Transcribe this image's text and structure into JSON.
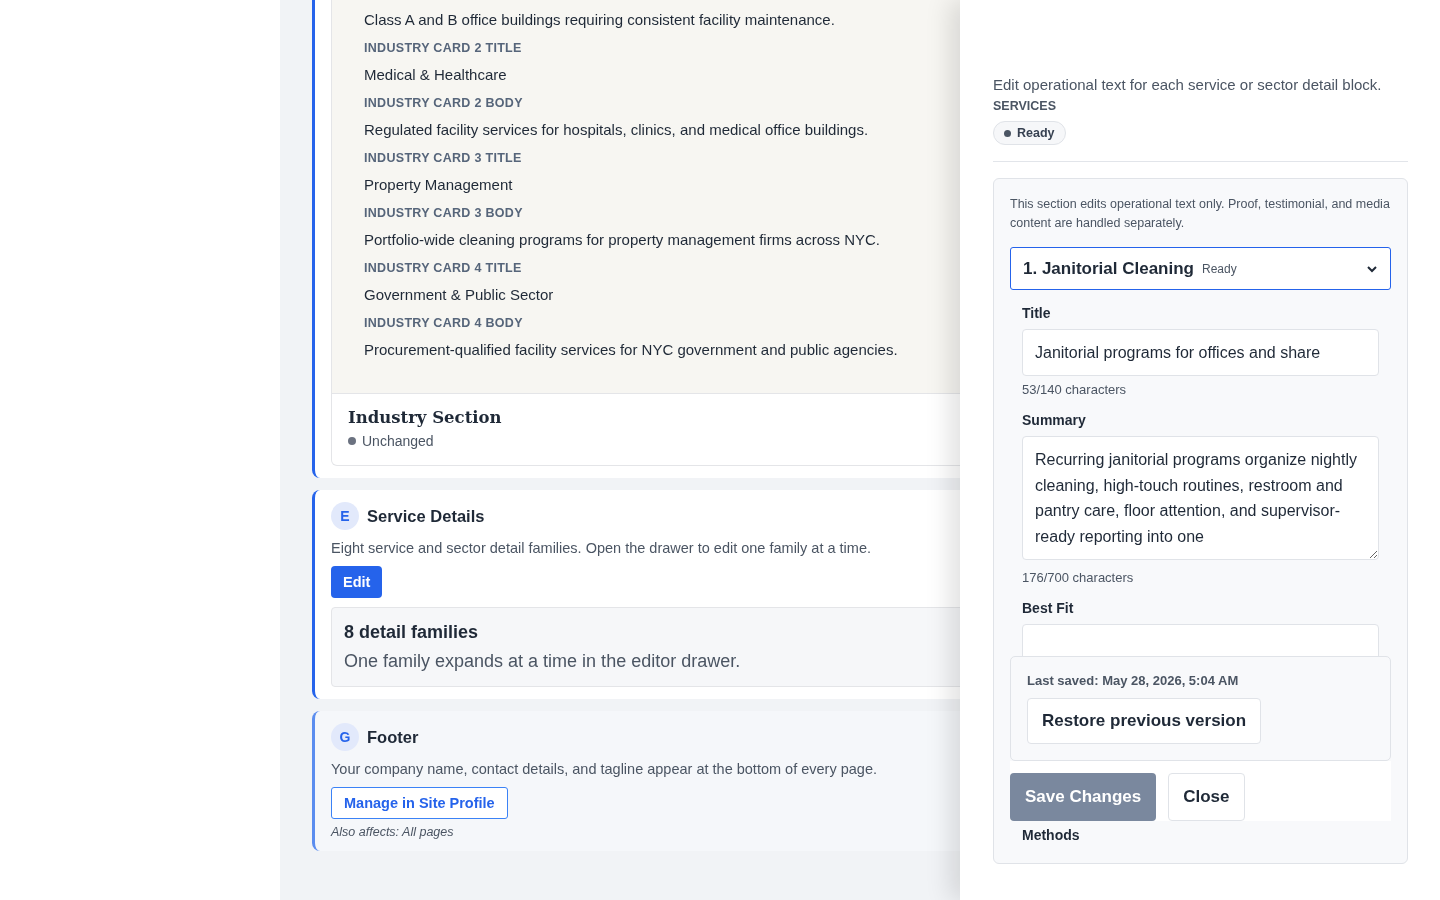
{
  "industry_panel": {
    "fields": [
      {
        "value": "Class A and B office buildings requiring consistent facility maintenance."
      },
      {
        "label": "INDUSTRY CARD 2 TITLE",
        "value": "Medical & Healthcare"
      },
      {
        "label": "INDUSTRY CARD 2 BODY",
        "value": "Regulated facility services for hospitals, clinics, and medical office buildings."
      },
      {
        "label": "INDUSTRY CARD 3 TITLE",
        "value": "Property Management"
      },
      {
        "label": "INDUSTRY CARD 3 BODY",
        "value": "Portfolio-wide cleaning programs for property management firms across NYC."
      },
      {
        "label": "INDUSTRY CARD 4 TITLE",
        "value": "Government & Public Sector"
      },
      {
        "label": "INDUSTRY CARD 4 BODY",
        "value": "Procurement-qualified facility services for NYC government and public agencies."
      }
    ],
    "title": "Industry Section",
    "status": "Unchanged"
  },
  "sections": [
    {
      "badge": "E",
      "title": "Service Details",
      "description": "Eight service and sector detail families. Open the drawer to edit one family at a time.",
      "button": {
        "label": "Edit",
        "kind": "primary"
      },
      "summary": {
        "title": "8 detail families",
        "text": "One family expands at a time in the editor drawer."
      },
      "selected": true
    },
    {
      "badge": "G",
      "title": "Footer",
      "description": "Your company name, contact details, and tagline appear at the bottom of every page.",
      "button": {
        "label": "Manage in Site Profile",
        "kind": "outline"
      },
      "note": "Also affects: All pages",
      "selected": false
    }
  ],
  "drawer": {
    "description": "Edit operational text for each service or sector detail block.",
    "section_label": "SERVICES",
    "status": "Ready",
    "note": "This section edits operational text only. Proof, testimonial, and media content are handled separately.",
    "dropdown": {
      "value": "1. Janitorial Cleaning",
      "status": "Ready"
    },
    "fields": [
      {
        "kind": "input",
        "label": "Title",
        "value": "Janitorial programs for offices and share",
        "counter": "53/140 characters"
      },
      {
        "kind": "textarea",
        "label": "Summary",
        "value": "Recurring janitorial programs organize nightly cleaning, high-touch routines, restroom and pantry care, floor attention, and supervisor-ready reporting into one",
        "counter": "176/700 characters"
      },
      {
        "kind": "input",
        "label": "Best Fit"
      }
    ],
    "last_saved": "Last saved: May 28, 2026, 5:04 AM",
    "restore_button": "Restore previous version",
    "save_button": {
      "label": "Save Changes",
      "disabled": true
    },
    "close_button": "Close",
    "next_label": "Methods"
  }
}
